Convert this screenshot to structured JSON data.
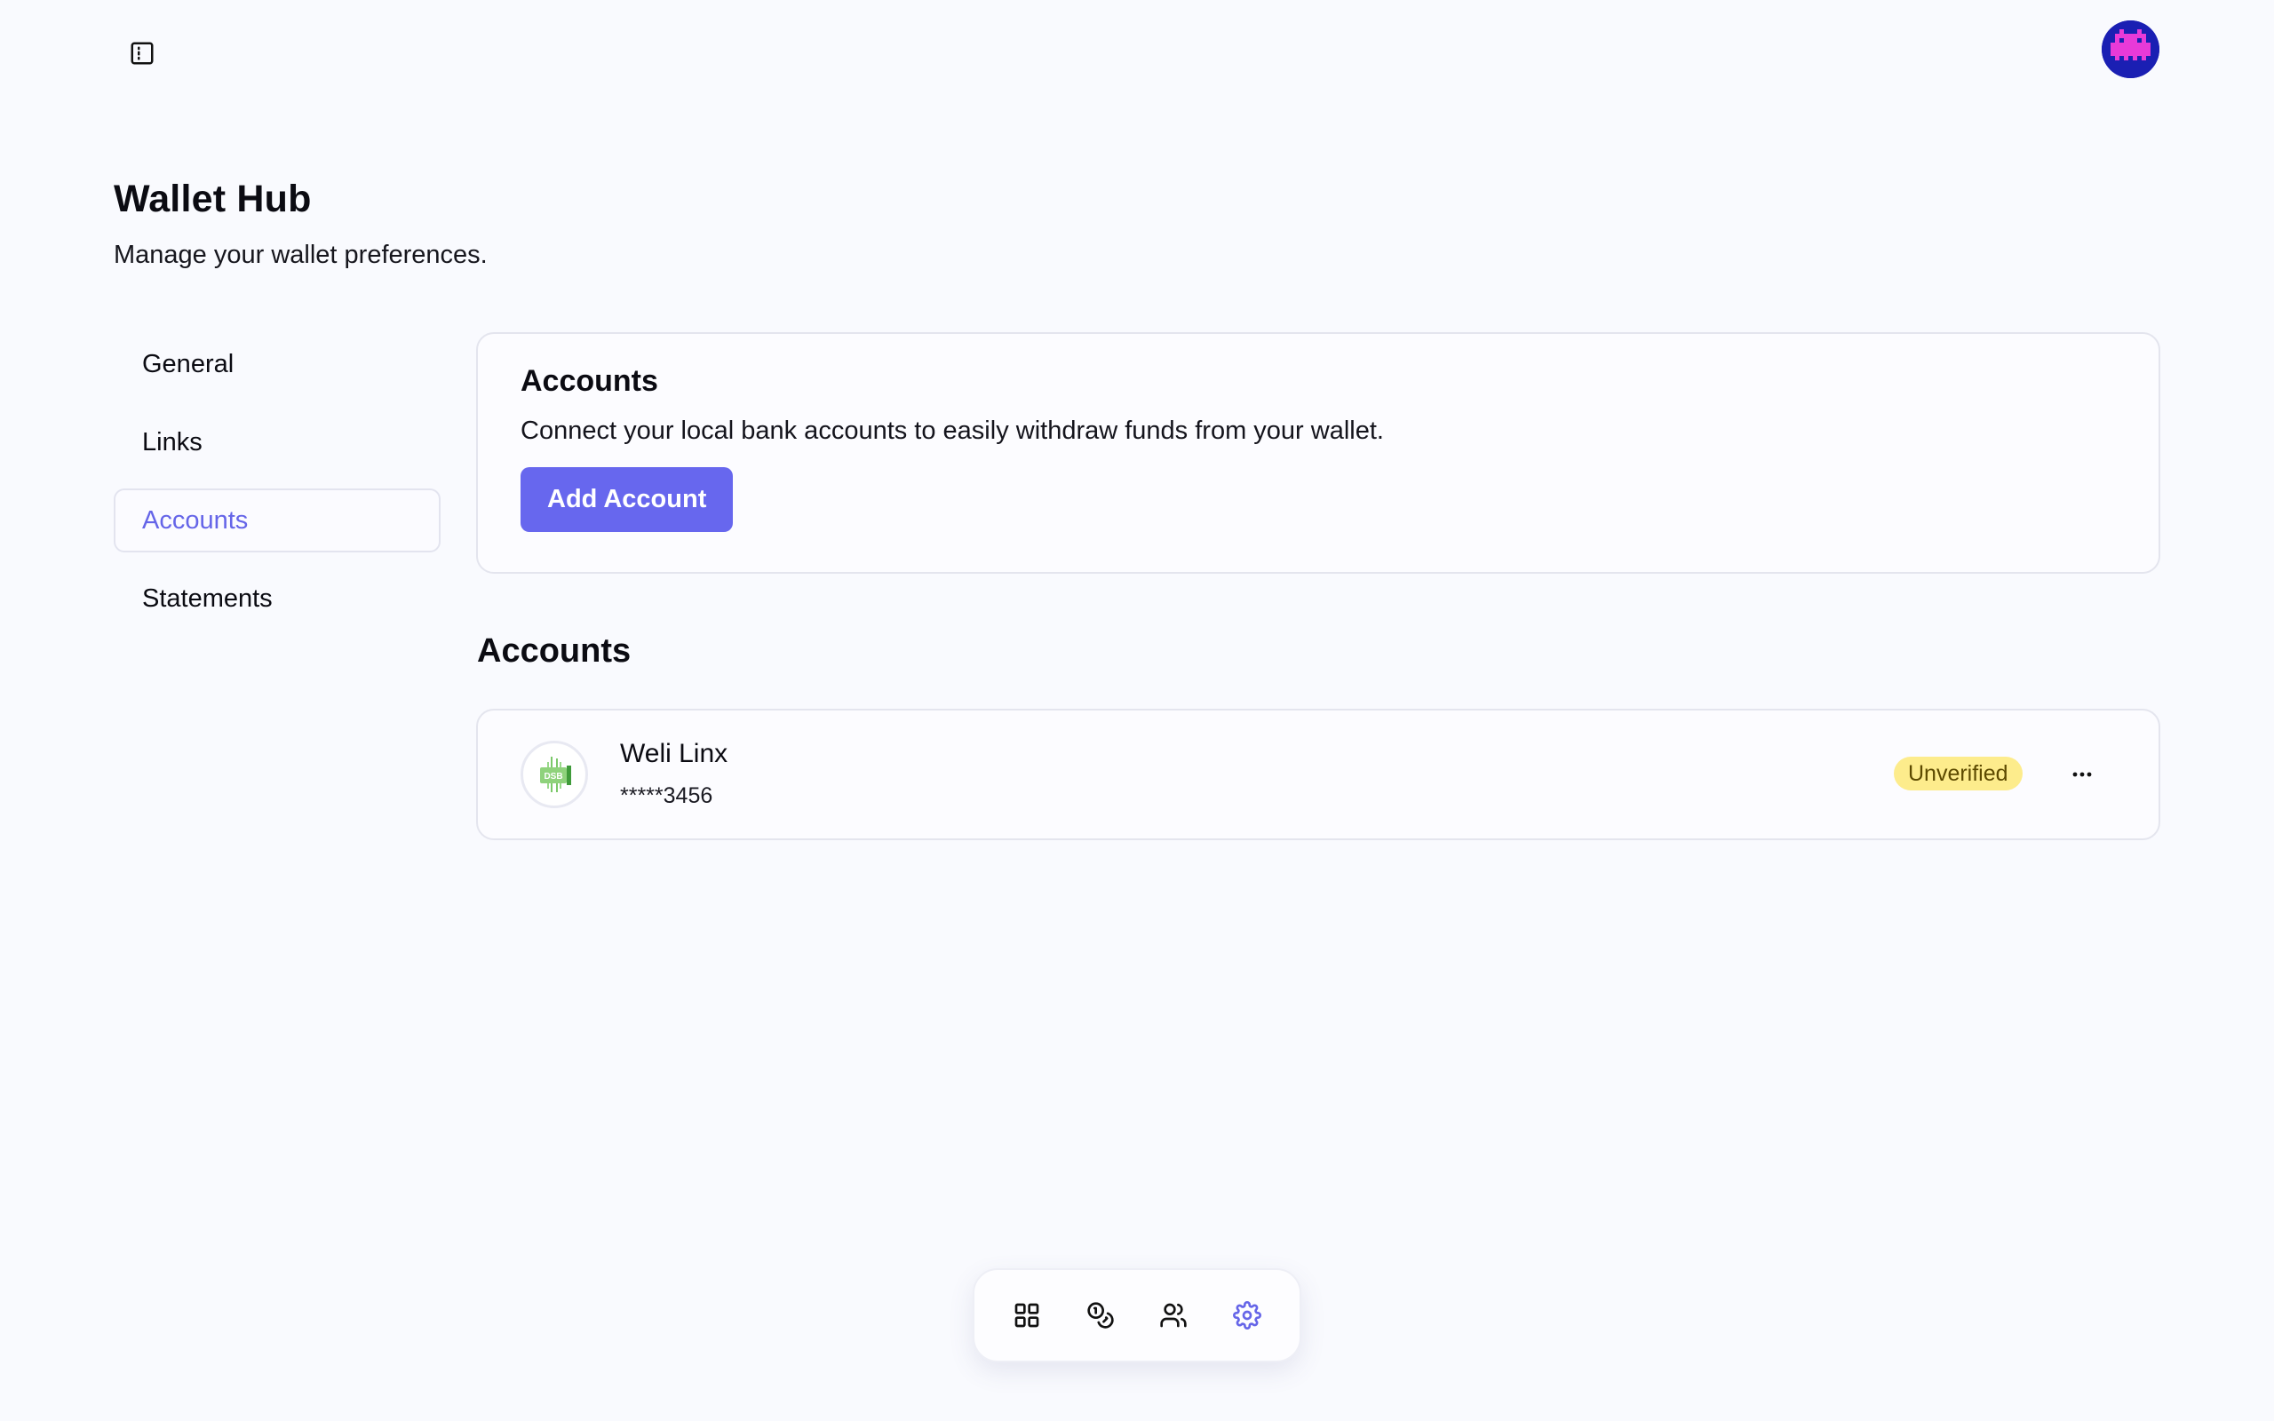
{
  "page": {
    "title": "Wallet Hub",
    "subtitle": "Manage your wallet preferences."
  },
  "topbar": {
    "sidebar_toggle_icon": "sidebar-toggle-icon",
    "avatar_icon": "pixel-avatar"
  },
  "nav": {
    "items": [
      {
        "label": "General",
        "active": false
      },
      {
        "label": "Links",
        "active": false
      },
      {
        "label": "Accounts",
        "active": true
      },
      {
        "label": "Statements",
        "active": false
      }
    ]
  },
  "add_card": {
    "title": "Accounts",
    "description": "Connect your local bank accounts to easily withdraw funds from your wallet.",
    "button_label": "Add Account"
  },
  "accounts_section": {
    "title": "Accounts",
    "items": [
      {
        "bank_logo_text": "DSB",
        "name": "Weli Linx",
        "number": "*****3456",
        "status": "Unverified",
        "more_icon": "more-horizontal-icon"
      }
    ]
  },
  "dock": {
    "items": [
      {
        "icon": "grid-icon",
        "active": false
      },
      {
        "icon": "coins-icon",
        "active": false
      },
      {
        "icon": "users-icon",
        "active": false
      },
      {
        "icon": "gear-icon",
        "active": true
      }
    ]
  },
  "colors": {
    "accent": "#6767ee",
    "active_nav_text": "#6565e8",
    "badge_bg": "#fdec8c",
    "background": "#f9fafe"
  }
}
